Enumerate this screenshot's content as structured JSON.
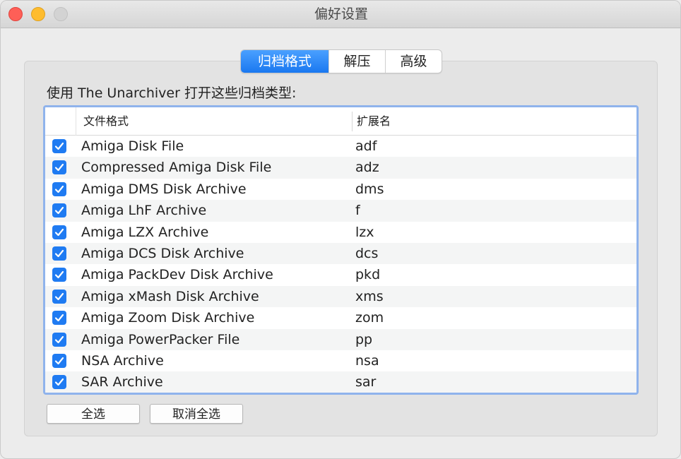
{
  "window": {
    "title": "偏好设置"
  },
  "tabs": [
    {
      "label": "归档格式",
      "active": true
    },
    {
      "label": "解压",
      "active": false
    },
    {
      "label": "高级",
      "active": false
    }
  ],
  "instruction": "使用 The Unarchiver 打开这些归档类型:",
  "table": {
    "headers": {
      "format": "文件格式",
      "extension": "扩展名"
    },
    "rows": [
      {
        "checked": true,
        "format": "Amiga Disk File",
        "extension": "adf"
      },
      {
        "checked": true,
        "format": "Compressed Amiga Disk File",
        "extension": "adz"
      },
      {
        "checked": true,
        "format": "Amiga DMS Disk Archive",
        "extension": "dms"
      },
      {
        "checked": true,
        "format": "Amiga LhF Archive",
        "extension": "f"
      },
      {
        "checked": true,
        "format": "Amiga LZX Archive",
        "extension": "lzx"
      },
      {
        "checked": true,
        "format": "Amiga DCS Disk Archive",
        "extension": "dcs"
      },
      {
        "checked": true,
        "format": "Amiga PackDev Disk Archive",
        "extension": "pkd"
      },
      {
        "checked": true,
        "format": "Amiga xMash Disk Archive",
        "extension": "xms"
      },
      {
        "checked": true,
        "format": "Amiga Zoom Disk Archive",
        "extension": "zom"
      },
      {
        "checked": true,
        "format": "Amiga PowerPacker File",
        "extension": "pp"
      },
      {
        "checked": true,
        "format": "NSA Archive",
        "extension": "nsa"
      },
      {
        "checked": true,
        "format": "SAR Archive",
        "extension": "sar"
      }
    ]
  },
  "buttons": {
    "select_all": "全选",
    "deselect_all": "取消全选"
  },
  "colors": {
    "accent": "#1f7bf2",
    "focus_ring": "#8fb3ec",
    "close": "#fe5f57",
    "minimize": "#febc2e"
  },
  "icons": {
    "checkbox": "checkmark-icon"
  }
}
